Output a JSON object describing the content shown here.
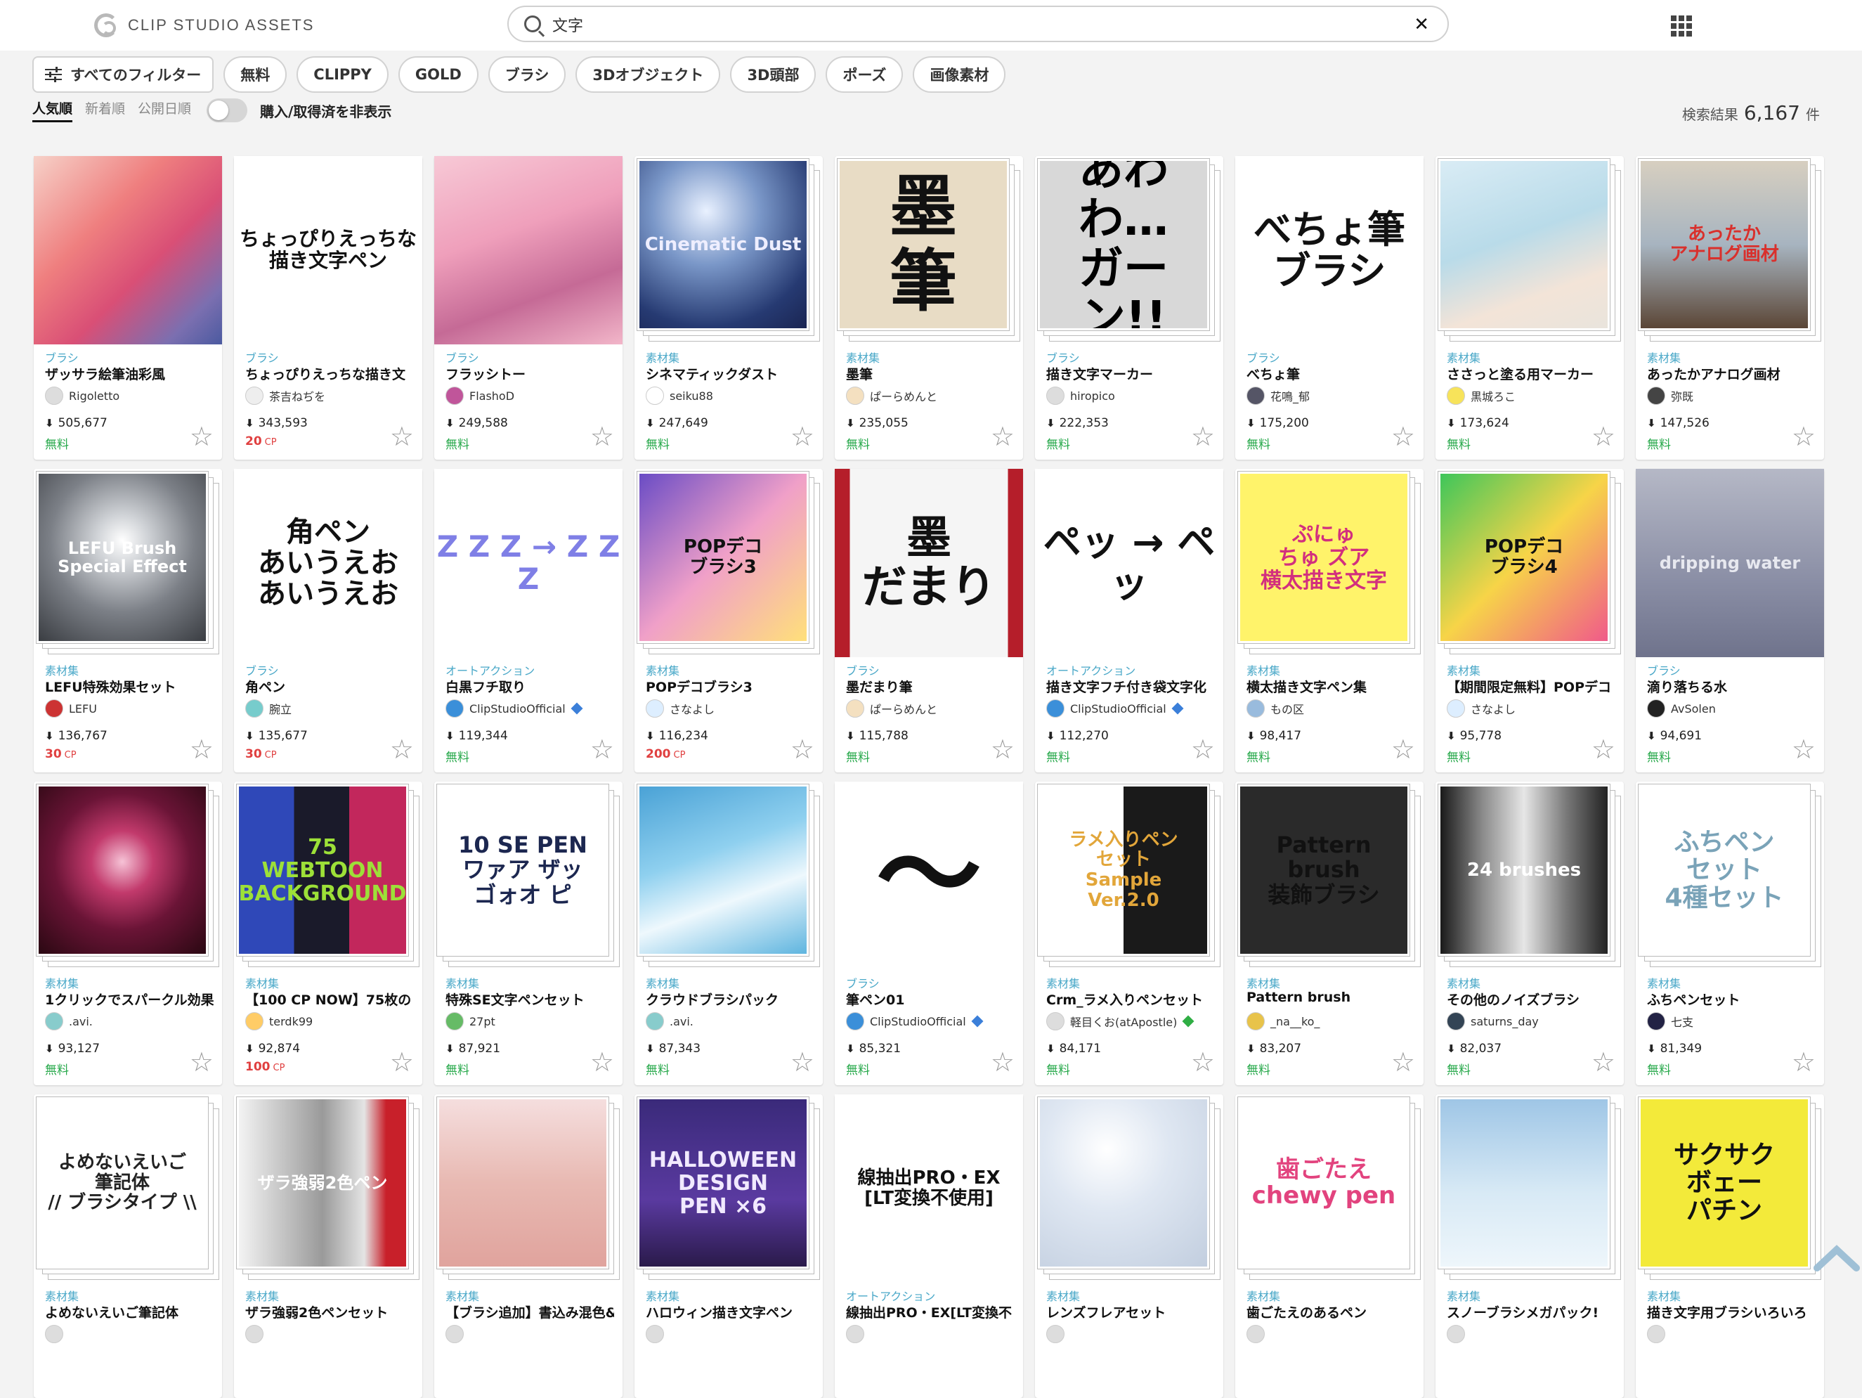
{
  "header": {
    "logo_text": "CLIP STUDIO ASSETS",
    "search_value": "文字",
    "clear_icon": "close-icon",
    "apps_icon": "grid-icon"
  },
  "filters": {
    "all_label": "すべてのフィルター",
    "chips": [
      "無料",
      "CLIPPY",
      "GOLD",
      "ブラシ",
      "3Dオブジェクト",
      "3D頭部",
      "ポーズ",
      "画像素材"
    ]
  },
  "sort": {
    "options": [
      "人気順",
      "新着順",
      "公開日順"
    ],
    "active": "人気順",
    "toggle_label": "購入/取得済を非表示"
  },
  "results": {
    "label": "検索結果",
    "count": "6,167",
    "unit": "件"
  },
  "colors": {
    "free": "#26a84a",
    "cp": "#e04040",
    "category": "#4aa8c8"
  },
  "cards": [
    {
      "category": "ブラシ",
      "title": "ザッサラ絵筆油彩風",
      "author": "Rigoletto",
      "downloads": "505,677",
      "price": "無料",
      "price_unit": "",
      "stack": false,
      "thumb_text": "",
      "thumb_bg": "linear-gradient(135deg,#f6d1c8 0%,#ef7f7f 35%,#d94f76 60%,#7b6fb0 85%,#4b5aa0 100%)",
      "thumb_color": "#fff",
      "thumb_size": "20px",
      "avatar_color": "#ddd"
    },
    {
      "category": "ブラシ",
      "title": "ちょっぴりえっちな描き文",
      "author": "茶吉ねぢを",
      "downloads": "343,593",
      "price": "20",
      "price_unit": "CP",
      "stack": false,
      "thumb_text": "ちょっぴりえっちな\n描き文字ペン",
      "thumb_bg": "#ffffff",
      "thumb_color": "#111",
      "thumb_size": "28px",
      "avatar_color": "#eee"
    },
    {
      "category": "ブラシ",
      "title": "フラッシトー",
      "author": "FlashoD",
      "downloads": "249,588",
      "price": "無料",
      "price_unit": "",
      "stack": false,
      "thumb_text": "",
      "thumb_bg": "linear-gradient(160deg,#f7c9d6 0%,#ef9fbb 40%,#c56a96 70%,#f2b6c9 100%)",
      "thumb_color": "#fff",
      "thumb_size": "20px",
      "avatar_color": "#c0559a"
    },
    {
      "category": "素材集",
      "title": "シネマティックダスト",
      "author": "seiku88",
      "downloads": "247,649",
      "price": "無料",
      "price_unit": "",
      "stack": true,
      "thumb_text": "Cinematic Dust",
      "thumb_bg": "radial-gradient(circle at 40% 30%,#e9f1ff 0%,#7a97c8 35%,#263a72 75%,#1a2552 100%)",
      "thumb_color": "#eef",
      "thumb_size": "26px",
      "avatar_color": "#fff"
    },
    {
      "category": "素材集",
      "title": "墨筆",
      "author": "ぱーらめんと",
      "downloads": "235,055",
      "price": "無料",
      "price_unit": "",
      "stack": true,
      "thumb_text": "墨\n筆",
      "thumb_bg": "#e8dcc5",
      "thumb_color": "#111",
      "thumb_size": "96px",
      "avatar_color": "#f4e0c0"
    },
    {
      "category": "ブラシ",
      "title": "描き文字マーカー",
      "author": "hiropico",
      "downloads": "222,353",
      "price": "無料",
      "price_unit": "",
      "stack": true,
      "thumb_text": "あわわ…\nガーン!!",
      "thumb_bg": "#d8d8d8",
      "thumb_color": "#000",
      "thumb_size": "64px",
      "avatar_color": "#ddd"
    },
    {
      "category": "ブラシ",
      "title": "べちょ筆",
      "author": "花鳴_郁",
      "downloads": "175,200",
      "price": "無料",
      "price_unit": "",
      "stack": false,
      "thumb_text": "べちょ筆\nブラシ",
      "thumb_bg": "#ffffff",
      "thumb_color": "#111",
      "thumb_size": "54px",
      "avatar_color": "#556"
    },
    {
      "category": "素材集",
      "title": "ささっと塗る用マーカー",
      "author": "黒城ろこ",
      "downloads": "173,624",
      "price": "無料",
      "price_unit": "",
      "stack": true,
      "thumb_text": "",
      "thumb_bg": "linear-gradient(160deg,#d9ecf5 0%,#b9dbe9 45%,#f3e4d8 75%,#e9e4dc 100%)",
      "thumb_color": "#fff",
      "thumb_size": "20px",
      "avatar_color": "#f7e35a"
    },
    {
      "category": "素材集",
      "title": "あったかアナログ画材",
      "author": "弥既",
      "downloads": "147,526",
      "price": "無料",
      "price_unit": "",
      "stack": true,
      "thumb_text": "あったか\nアナログ画材",
      "thumb_bg": "linear-gradient(180deg,#d7cfc0 0%,#a7b4c0 50%,#5b4636 100%)",
      "thumb_color": "#d9302c",
      "thumb_size": "26px",
      "avatar_color": "#444"
    },
    {
      "category": "素材集",
      "title": "LEFU特殊効果セット",
      "author": "LEFU",
      "downloads": "136,767",
      "price": "30",
      "price_unit": "CP",
      "stack": true,
      "thumb_text": "LEFU Brush\nSpecial Effect",
      "thumb_bg": "radial-gradient(circle at 50% 40%,#ffffff 0%,#cfd2d6 20%,#7c8087 55%,#3a3d42 100%)",
      "thumb_color": "#fff",
      "thumb_size": "24px",
      "avatar_color": "#c33"
    },
    {
      "category": "ブラシ",
      "title": "角ペン",
      "author": "腕立",
      "downloads": "135,677",
      "price": "30",
      "price_unit": "CP",
      "stack": false,
      "thumb_text": "角ペン\nあいうえお\nあいうえお",
      "thumb_bg": "#ffffff",
      "thumb_color": "#111",
      "thumb_size": "40px",
      "avatar_color": "#7cc"
    },
    {
      "category": "オートアクション",
      "title": "白黒フチ取り",
      "author": "ClipStudioOfficial",
      "downloads": "119,344",
      "price": "無料",
      "price_unit": "",
      "stack": false,
      "thumb_text": "Z Z Z → Z Z Z",
      "thumb_bg": "#ffffff",
      "thumb_color": "#7f7fe6",
      "thumb_size": "42px",
      "avatar_color": "#3b8fd9",
      "verified": "#3b7fd9"
    },
    {
      "category": "素材集",
      "title": "POPデコブラシ3",
      "author": "さなよし",
      "downloads": "116,234",
      "price": "200",
      "price_unit": "CP",
      "stack": true,
      "thumb_text": "POPデコ\nブラシ3",
      "thumb_bg": "linear-gradient(135deg,#6a4cc5 0%,#f0a0c8 50%,#ffe07a 100%)",
      "thumb_color": "#111",
      "thumb_size": "26px",
      "avatar_color": "#def"
    },
    {
      "category": "ブラシ",
      "title": "墨だまり筆",
      "author": "ぱーらめんと",
      "downloads": "115,788",
      "price": "無料",
      "price_unit": "",
      "stack": false,
      "thumb_text": "墨\nだまり",
      "thumb_bg": "linear-gradient(90deg,#b51e2a 0%,#b51e2a 8%,#f5f5f5 8%,#f5f5f5 92%,#b51e2a 92%)",
      "thumb_color": "#111",
      "thumb_size": "64px",
      "avatar_color": "#f4e0c0"
    },
    {
      "category": "オートアクション",
      "title": "描き文字フチ付き袋文字化",
      "author": "ClipStudioOfficial",
      "downloads": "112,270",
      "price": "無料",
      "price_unit": "",
      "stack": false,
      "thumb_text": "ペッ → ペッ",
      "thumb_bg": "#ffffff",
      "thumb_color": "#111",
      "thumb_size": "54px",
      "avatar_color": "#3b8fd9",
      "verified": "#3b7fd9"
    },
    {
      "category": "素材集",
      "title": "横太描き文字ペン集",
      "author": "もの区",
      "downloads": "98,417",
      "price": "無料",
      "price_unit": "",
      "stack": true,
      "thumb_text": "ぷにゅ\nちゅ ズア\n横太描き文字",
      "thumb_bg": "#fff36a",
      "thumb_color": "#d22f7e",
      "thumb_size": "30px",
      "avatar_color": "#9bd"
    },
    {
      "category": "素材集",
      "title": "【期間限定無料】POPデコ",
      "author": "さなよし",
      "downloads": "95,778",
      "price": "無料",
      "price_unit": "",
      "stack": true,
      "thumb_text": "POPデコ\nブラシ4",
      "thumb_bg": "linear-gradient(135deg,#3ec65a 0%,#f7d448 50%,#f05a8a 100%)",
      "thumb_color": "#111",
      "thumb_size": "26px",
      "avatar_color": "#def"
    },
    {
      "category": "ブラシ",
      "title": "滴り落ちる水",
      "author": "AvSolen",
      "downloads": "94,691",
      "price": "無料",
      "price_unit": "",
      "stack": false,
      "thumb_text": "dripping water",
      "thumb_bg": "linear-gradient(180deg,#b5b8c6 0%,#8a8ea5 60%,#6f738c 100%)",
      "thumb_color": "#e7e8ef",
      "thumb_size": "24px",
      "avatar_color": "#222"
    },
    {
      "category": "素材集",
      "title": "1クリックでスパークル効果",
      "author": ".avi.",
      "downloads": "93,127",
      "price": "無料",
      "price_unit": "",
      "stack": true,
      "thumb_text": "",
      "thumb_bg": "radial-gradient(circle at 50% 45%,#f6c2d6 0%,#c23a6c 25%,#6a1436 55%,#2a0812 100%)",
      "thumb_color": "#fff",
      "thumb_size": "20px",
      "avatar_color": "#8cc"
    },
    {
      "category": "素材集",
      "title": "【100 CP NOW】75枚の",
      "author": "terdk99",
      "downloads": "92,874",
      "price": "100",
      "price_unit": "CP",
      "stack": true,
      "thumb_text": "75\nWEBTOON\nBACKGROUND",
      "thumb_bg": "linear-gradient(90deg,#2f48b8 0%,#2f48b8 33%,#1a1a2a 33%,#1a1a2a 66%,#c2275c 66%)",
      "thumb_color": "#9de038",
      "thumb_size": "30px",
      "avatar_color": "#fc6"
    },
    {
      "category": "素材集",
      "title": "特殊SE文字ペンセット",
      "author": "27pt",
      "downloads": "87,921",
      "price": "無料",
      "price_unit": "",
      "stack": true,
      "thumb_text": "10 SE PEN\nワァア ザッ\nゴォオ ピ",
      "thumb_bg": "#ffffff",
      "thumb_color": "#1c2750",
      "thumb_size": "32px",
      "avatar_color": "#6b6"
    },
    {
      "category": "素材集",
      "title": "クラウドブラシパック",
      "author": ".avi.",
      "downloads": "87,343",
      "price": "無料",
      "price_unit": "",
      "stack": true,
      "thumb_text": "",
      "thumb_bg": "linear-gradient(160deg,#4aa2d6 0%,#8fd0ef 40%,#eef8fd 65%,#5fb5df 100%)",
      "thumb_color": "#fff",
      "thumb_size": "20px",
      "avatar_color": "#8cc"
    },
    {
      "category": "ブラシ",
      "title": "筆ペン01",
      "author": "ClipStudioOfficial",
      "downloads": "85,321",
      "price": "無料",
      "price_unit": "",
      "stack": false,
      "thumb_text": "〜",
      "thumb_bg": "#ffffff",
      "thumb_color": "#111",
      "thumb_size": "150px",
      "avatar_color": "#3b8fd9",
      "verified": "#3b7fd9"
    },
    {
      "category": "素材集",
      "title": "Crm_ラメ入りペンセット",
      "author": "軽目くお(atApostle)",
      "downloads": "84,171",
      "price": "無料",
      "price_unit": "",
      "stack": true,
      "thumb_text": "ラメ入りペン\nセット\nSample\nVer.2.0",
      "thumb_bg": "linear-gradient(90deg,#ffffff 0%,#ffffff 50%,#1a1a1a 50%,#1a1a1a 100%)",
      "thumb_color": "#e2a63a",
      "thumb_size": "26px",
      "avatar_color": "#ddd",
      "verified": "#2fae44"
    },
    {
      "category": "素材集",
      "title": "Pattern brush",
      "author": "_na__ko_",
      "downloads": "83,207",
      "price": "無料",
      "price_unit": "",
      "stack": true,
      "thumb_text": "Pattern brush\n装飾ブラシ",
      "thumb_bg": "#2a2a2a",
      "thumb_color": "#111",
      "thumb_size": "32px",
      "avatar_color": "#e8c34a"
    },
    {
      "category": "素材集",
      "title": "その他のノイズブラシ",
      "author": "saturns_day",
      "downloads": "82,037",
      "price": "無料",
      "price_unit": "",
      "stack": true,
      "thumb_text": "24 brushes",
      "thumb_bg": "linear-gradient(90deg,#1a1a1a 0%,#8a8a8a 25%,#e6e6e6 50%,#7a7a7a 75%,#222 100%)",
      "thumb_color": "#fff",
      "thumb_size": "26px",
      "avatar_color": "#345"
    },
    {
      "category": "素材集",
      "title": "ふちペンセット",
      "author": "七支",
      "downloads": "81,349",
      "price": "無料",
      "price_unit": "",
      "stack": true,
      "thumb_text": "ふちペン\nセット\n4種セット",
      "thumb_bg": "#ffffff",
      "thumb_color": "#7aa3b8",
      "thumb_size": "36px",
      "avatar_color": "#224"
    },
    {
      "category": "素材集",
      "title": "よめないえいご筆記体",
      "author": "",
      "downloads": "",
      "price": "",
      "price_unit": "",
      "stack": true,
      "thumb_text": "よめないえいご\n筆記体\n// ブラシタイプ \\\\",
      "thumb_bg": "#ffffff",
      "thumb_color": "#222",
      "thumb_size": "26px",
      "avatar_color": "#ddd"
    },
    {
      "category": "素材集",
      "title": "ザラ強弱2色ペンセット",
      "author": "",
      "downloads": "",
      "price": "",
      "price_unit": "",
      "stack": true,
      "thumb_text": "ザラ強弱2色ペン",
      "thumb_bg": "linear-gradient(90deg,#f3f3f3 0%,#9a9a9a 50%,#e4e4e4 75%,#c8202a 88%)",
      "thumb_color": "#fff",
      "thumb_size": "24px",
      "avatar_color": "#ddd"
    },
    {
      "category": "素材集",
      "title": "【ブラシ追加】書込み混色&",
      "author": "",
      "downloads": "",
      "price": "",
      "price_unit": "",
      "stack": true,
      "thumb_text": "",
      "thumb_bg": "linear-gradient(180deg,#f5dede 0%,#e8b9b2 50%,#e0a39d 100%)",
      "thumb_color": "#fff",
      "thumb_size": "20px",
      "avatar_color": "#ddd"
    },
    {
      "category": "素材集",
      "title": "ハロウィン描き文字ペン",
      "author": "",
      "downloads": "",
      "price": "",
      "price_unit": "",
      "stack": true,
      "thumb_text": "HALLOWEEN\nDESIGN\nPEN ×6",
      "thumb_bg": "linear-gradient(180deg,#3a2a7a 0%,#5a3aa0 60%,#2a1a4a 100%)",
      "thumb_color": "#f1e9ff",
      "thumb_size": "30px",
      "avatar_color": "#ddd"
    },
    {
      "category": "オートアクション",
      "title": "線抽出PRO・EX[LT変換不",
      "author": "",
      "downloads": "",
      "price": "",
      "price_unit": "",
      "stack": false,
      "thumb_text": "線抽出PRO・EX\n[LT変換不使用]",
      "thumb_bg": "#ffffff",
      "thumb_color": "#111",
      "thumb_size": "26px",
      "avatar_color": "#ddd"
    },
    {
      "category": "素材集",
      "title": "レンズフレアセット",
      "author": "",
      "downloads": "",
      "price": "",
      "price_unit": "",
      "stack": true,
      "thumb_text": "",
      "thumb_bg": "radial-gradient(circle at 40% 30%,#ffffff 0%,#dfe7f2 40%,#c2cedf 100%)",
      "thumb_color": "#fff",
      "thumb_size": "20px",
      "avatar_color": "#ddd"
    },
    {
      "category": "素材集",
      "title": "歯ごたえのあるペン",
      "author": "",
      "downloads": "",
      "price": "",
      "price_unit": "",
      "stack": true,
      "thumb_text": "歯ごたえ\nchewy pen",
      "thumb_bg": "#ffffff",
      "thumb_color": "#e2437e",
      "thumb_size": "34px",
      "avatar_color": "#ddd"
    },
    {
      "category": "素材集",
      "title": "スノーブラシメガパック!",
      "author": "",
      "downloads": "",
      "price": "",
      "price_unit": "",
      "stack": true,
      "thumb_text": "",
      "thumb_bg": "linear-gradient(180deg,#9fc6e6 0%,#d7e9f5 55%,#eef6fb 100%)",
      "thumb_color": "#fff",
      "thumb_size": "20px",
      "avatar_color": "#ddd"
    },
    {
      "category": "素材集",
      "title": "描き文字用ブラシいろいろ",
      "author": "",
      "downloads": "",
      "price": "",
      "price_unit": "",
      "stack": true,
      "thumb_text": "サクサク\nボェー\nパチン",
      "thumb_bg": "#f3ea3a",
      "thumb_color": "#111",
      "thumb_size": "36px",
      "avatar_color": "#ddd"
    }
  ]
}
